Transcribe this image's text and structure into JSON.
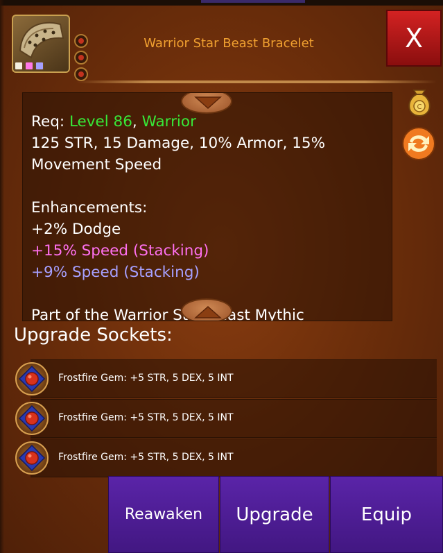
{
  "item": {
    "title": "Warrior Star Beast Bracelet",
    "gem_dot_colors": [
      "#f5f0e0",
      "#ff78e8",
      "#a6a0ff"
    ]
  },
  "close": {
    "label": "X"
  },
  "description": {
    "req_label": "Req:",
    "req_level": "Level 86",
    "req_sep": ",",
    "req_class": "Warrior",
    "stats_line1": "125 STR, 15 Damage, 10% Armor, 15%",
    "stats_line2": "Movement Speed",
    "enh_title": "Enhancements:",
    "enh_1": "+2% Dodge",
    "enh_2": "+15% Speed (Stacking)",
    "enh_3": "+9% Speed (Stacking)",
    "set_line": "Part of the Warrior Star Beast Mythic"
  },
  "sockets": {
    "title": "Upgrade Sockets:",
    "items": [
      {
        "label": "Frostfire Gem: +5 STR, 5 DEX, 5 INT"
      },
      {
        "label": "Frostfire Gem: +5 STR, 5 DEX, 5 INT"
      },
      {
        "label": "Frostfire Gem: +5 STR, 5 DEX, 5 INT"
      }
    ]
  },
  "actions": {
    "reawaken": "Reawaken",
    "upgrade": "Upgrade",
    "equip": "Equip"
  },
  "icons": {
    "sell": "coin-bag-icon",
    "swap": "swap-arrows-icon",
    "scroll_up": "arrow-down-icon",
    "scroll_down": "arrow-up-icon"
  },
  "colors": {
    "title": "#f0a030",
    "req_green": "#38e838",
    "pink_enh": "#ff70f0",
    "lavender_enh": "#a6a0ff",
    "close_red": "#c81c1c",
    "button_purple": "#4e1d96"
  }
}
